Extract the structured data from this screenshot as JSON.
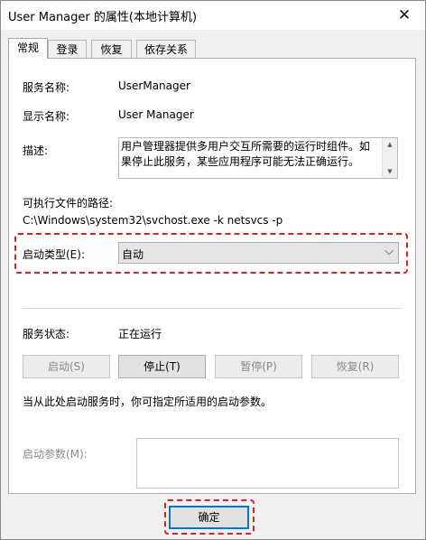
{
  "window": {
    "title": "User Manager 的属性(本地计算机)",
    "close_glyph": "✕"
  },
  "tabs": [
    {
      "label": "常规",
      "active": true
    },
    {
      "label": "登录",
      "active": false
    },
    {
      "label": "恢复",
      "active": false
    },
    {
      "label": "依存关系",
      "active": false
    }
  ],
  "general": {
    "service_name_label": "服务名称:",
    "service_name_value": "UserManager",
    "display_name_label": "显示名称:",
    "display_name_value": "User Manager",
    "description_label": "描述:",
    "description_value": "用户管理器提供多用户交互所需要的运行时组件。如果停止此服务，某些应用程序可能无法正确运行。",
    "exe_path_label": "可执行文件的路径:",
    "exe_path_value": "C:\\Windows\\system32\\svchost.exe -k netsvcs -p",
    "startup_type_label": "启动类型(E):",
    "startup_type_value": "自动",
    "service_status_label": "服务状态:",
    "service_status_value": "正在运行",
    "buttons": {
      "start": "启动(S)",
      "stop": "停止(T)",
      "pause": "暂停(P)",
      "resume": "恢复(R)"
    },
    "hint_text": "当从此处启动服务时，你可指定所适用的启动参数。",
    "start_params_label": "启动参数(M):",
    "start_params_value": ""
  },
  "footer": {
    "ok_label": "确定"
  },
  "colors": {
    "highlight_dashes": "#e41e1e",
    "focus_border": "#0078d7"
  },
  "icons": {
    "select_arrow": "chevron-down-icon",
    "scroll_up": "scroll-up-icon",
    "scroll_down": "scroll-down-icon"
  }
}
